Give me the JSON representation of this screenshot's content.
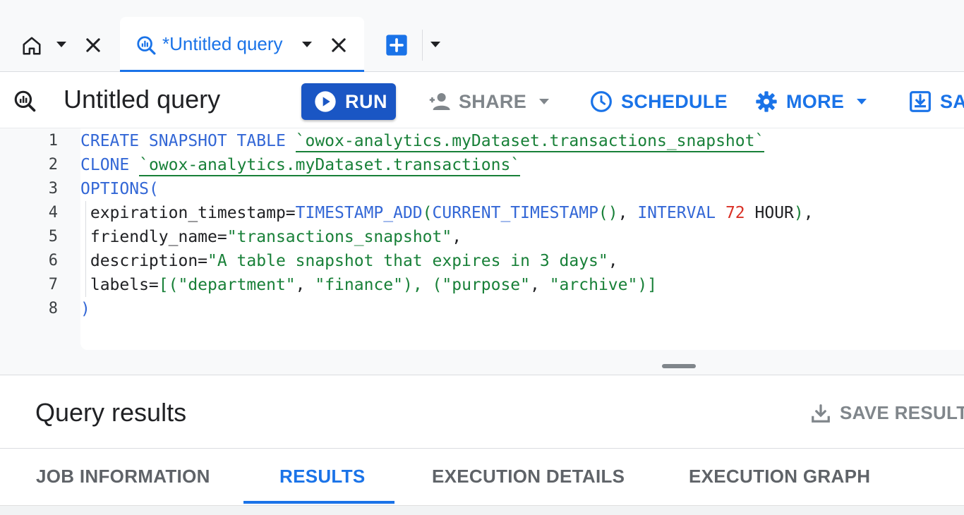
{
  "tabs": {
    "home_tab": {
      "icon": "home-icon"
    },
    "active_tab": {
      "title": "*Untitled query",
      "icon": "query-icon"
    },
    "new_tab_icon": "plus-box-icon"
  },
  "toolbar": {
    "title": "Untitled query",
    "run_label": "RUN",
    "share_label": "SHARE",
    "schedule_label": "SCHEDULE",
    "more_label": "MORE",
    "save_label": "SA"
  },
  "editor": {
    "line_numbers": [
      "1",
      "2",
      "3",
      "4",
      "5",
      "6",
      "7",
      "8"
    ],
    "lines": [
      [
        {
          "t": "CREATE SNAPSHOT TABLE ",
          "c": "kw"
        },
        {
          "t": "`owox-analytics.myDataset.transactions_snapshot`",
          "c": "bt"
        }
      ],
      [
        {
          "t": "CLONE ",
          "c": "kw"
        },
        {
          "t": "`owox-analytics.myDataset.transactions`",
          "c": "bt"
        }
      ],
      [
        {
          "t": "OPTIONS",
          "c": "kw"
        },
        {
          "t": "(",
          "c": "kw"
        }
      ],
      [
        {
          "t": " expiration_timestamp=",
          "c": "pun"
        },
        {
          "t": "TIMESTAMP_ADD",
          "c": "fn"
        },
        {
          "t": "(",
          "c": "str"
        },
        {
          "t": "CURRENT_TIMESTAMP",
          "c": "fn"
        },
        {
          "t": "()",
          "c": "str"
        },
        {
          "t": ", ",
          "c": "pun"
        },
        {
          "t": "INTERVAL ",
          "c": "kw"
        },
        {
          "t": "72",
          "c": "num"
        },
        {
          "t": " HOUR",
          "c": "pun"
        },
        {
          "t": ")",
          "c": "str"
        },
        {
          "t": ",",
          "c": "pun"
        }
      ],
      [
        {
          "t": " friendly_name=",
          "c": "pun"
        },
        {
          "t": "\"transactions_snapshot\"",
          "c": "str"
        },
        {
          "t": ",",
          "c": "pun"
        }
      ],
      [
        {
          "t": " description=",
          "c": "pun"
        },
        {
          "t": "\"A table snapshot that expires in 3 days\"",
          "c": "str"
        },
        {
          "t": ",",
          "c": "pun"
        }
      ],
      [
        {
          "t": " labels=",
          "c": "pun"
        },
        {
          "t": "[(",
          "c": "str"
        },
        {
          "t": "\"department\"",
          "c": "str"
        },
        {
          "t": ", ",
          "c": "pun"
        },
        {
          "t": "\"finance\"",
          "c": "str"
        },
        {
          "t": "), (",
          "c": "str"
        },
        {
          "t": "\"purpose\"",
          "c": "str"
        },
        {
          "t": ", ",
          "c": "pun"
        },
        {
          "t": "\"archive\"",
          "c": "str"
        },
        {
          "t": ")]",
          "c": "str"
        }
      ],
      [
        {
          "t": ")",
          "c": "kw"
        }
      ]
    ]
  },
  "results": {
    "title": "Query results",
    "save_results_label": "SAVE RESULTS",
    "tabs": [
      {
        "label": "JOB INFORMATION",
        "active": false
      },
      {
        "label": "RESULTS",
        "active": true
      },
      {
        "label": "EXECUTION DETAILS",
        "active": false
      },
      {
        "label": "EXECUTION GRAPH",
        "active": false
      }
    ]
  },
  "colors": {
    "accent": "#1a73e8",
    "run_button": "#1a56c4",
    "keyword": "#3367d6",
    "string": "#188038",
    "number": "#d93025"
  }
}
